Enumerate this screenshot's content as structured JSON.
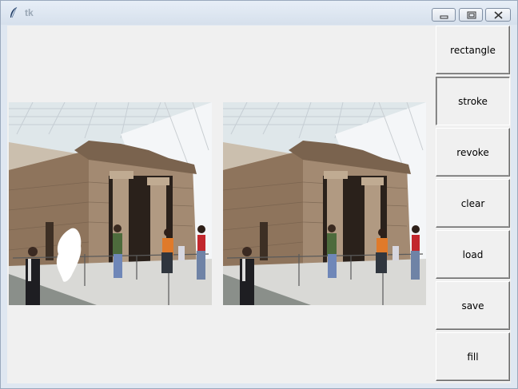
{
  "window": {
    "title": "tk",
    "controls": [
      "minimize-icon",
      "maximize-icon",
      "close-icon"
    ]
  },
  "toolbar": {
    "buttons": [
      {
        "label": "rectangle",
        "active": false
      },
      {
        "label": "stroke",
        "active": true
      },
      {
        "label": "revoke",
        "active": false
      },
      {
        "label": "clear",
        "active": false
      },
      {
        "label": "load",
        "active": false
      },
      {
        "label": "save",
        "active": false
      },
      {
        "label": "fill",
        "active": false
      }
    ]
  },
  "images": [
    {
      "name": "masked-input-image",
      "has_mask": true
    },
    {
      "name": "result-image",
      "has_mask": false
    }
  ],
  "colors": {
    "client_bg": "#f0f0f0",
    "title_text": "#9aa7b5",
    "mask": "#ffffff"
  }
}
